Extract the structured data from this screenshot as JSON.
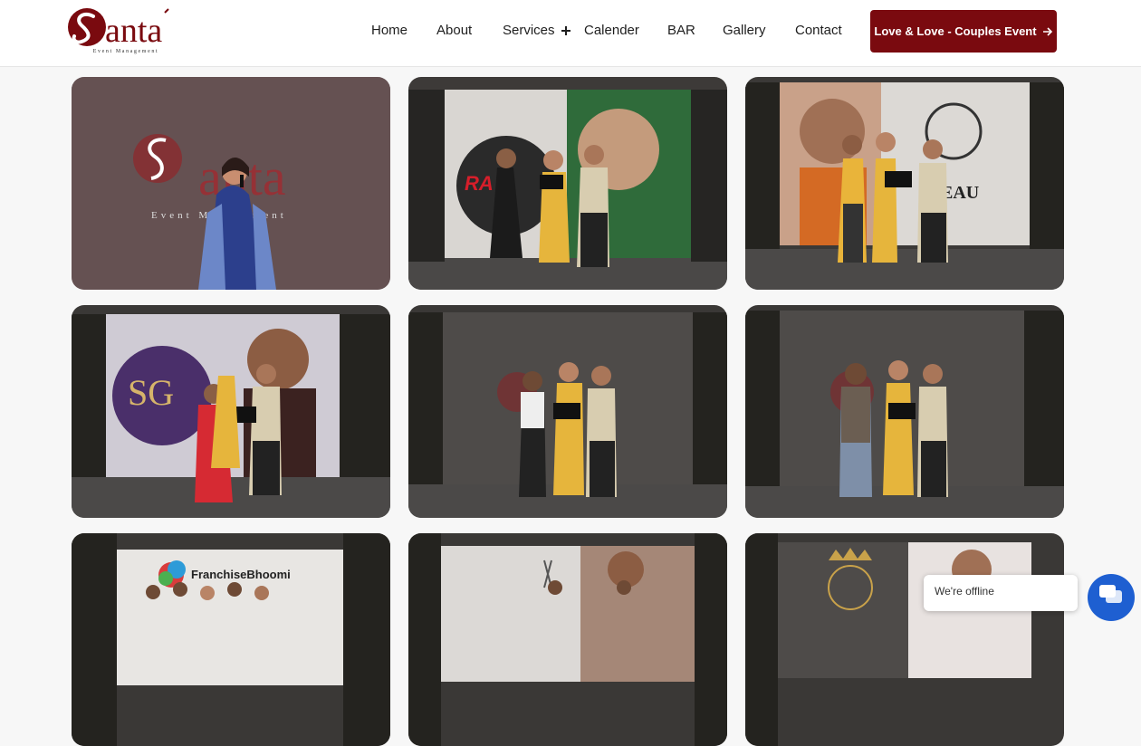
{
  "header": {
    "logo": {
      "text": "anta",
      "tagline": "Event Management"
    },
    "nav": [
      {
        "label": "Home"
      },
      {
        "label": "About"
      },
      {
        "label": "Services"
      },
      {
        "label": "Calender"
      },
      {
        "label": "BAR"
      },
      {
        "label": "Gallery"
      },
      {
        "label": "Contact"
      }
    ],
    "cta": {
      "label": "Love & Love - Couples Event",
      "icon": "arrow-right-icon"
    }
  },
  "gallery": {
    "photos": [
      {
        "name": "photo-speaker-santa",
        "backdrop_text": "Event Management"
      },
      {
        "name": "photo-award-rajma",
        "backdrop_text": "RA"
      },
      {
        "name": "photo-award-bureau",
        "backdrop_text": "EAU"
      },
      {
        "name": "photo-award-sg-boutique",
        "backdrop_text": "SG"
      },
      {
        "name": "photo-award-dark-stage-1",
        "backdrop_text": ""
      },
      {
        "name": "photo-award-dark-stage-2",
        "backdrop_text": ""
      },
      {
        "name": "photo-franchisebhoomi",
        "backdrop_text": "FranchiseBhoomi"
      },
      {
        "name": "photo-stage-portrait",
        "backdrop_text": ""
      },
      {
        "name": "photo-stage-crown",
        "backdrop_text": ""
      }
    ]
  },
  "chat": {
    "status_text": "We're offline",
    "icon": "chat-icon"
  },
  "colors": {
    "brand": "#7a0a0f",
    "chat_accent": "#1e5fd1"
  }
}
